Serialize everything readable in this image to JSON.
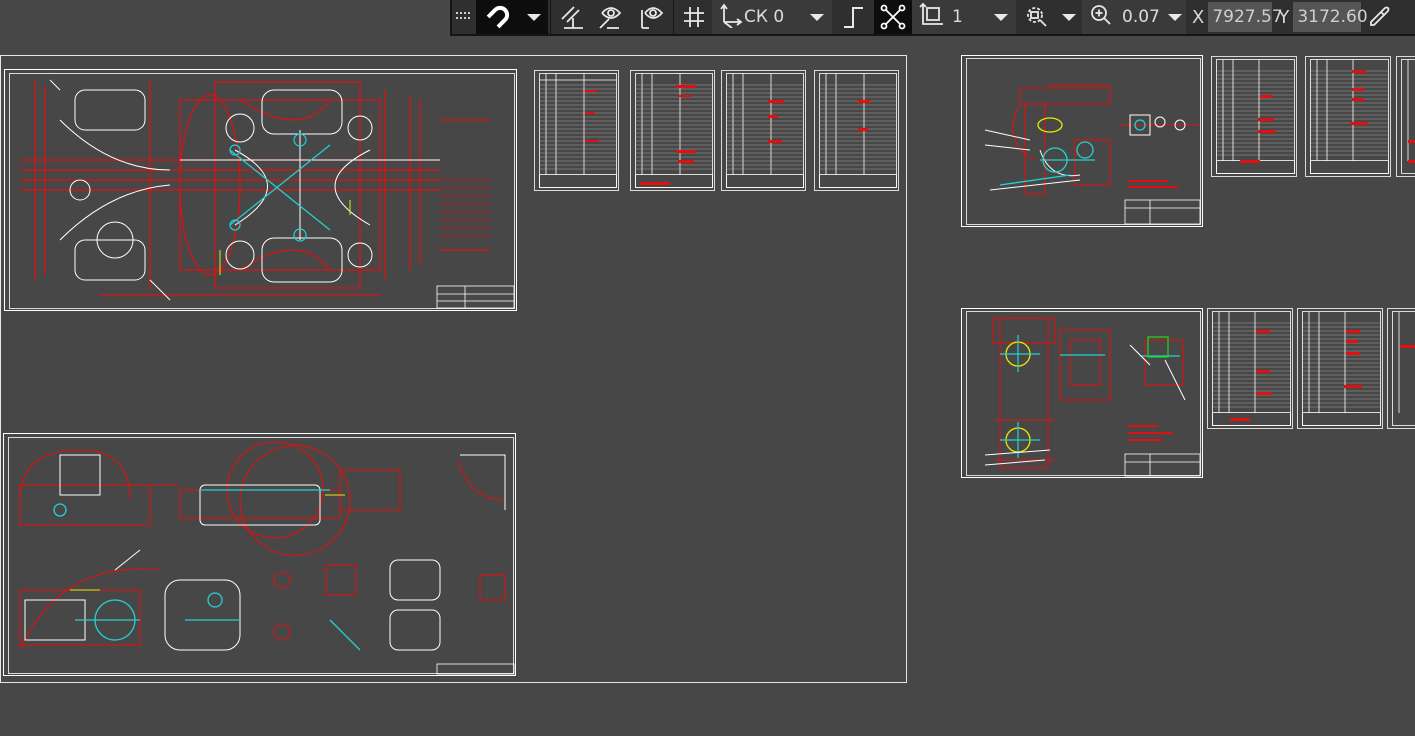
{
  "toolbar": {
    "coordinate_system": "СК 0",
    "layer_value": "1",
    "zoom_value": "0.07",
    "x_label": "X",
    "x_value": "7927.57",
    "y_label": "Y",
    "y_value": "3172.60"
  },
  "colors": {
    "canvas": "#474747",
    "drawing_red": "#e01010",
    "drawing_white": "#ffffff",
    "drawing_cyan": "#22d3d3",
    "drawing_yellow": "#e8e800",
    "drawing_green": "#20d020"
  },
  "icons": [
    "grip-icon",
    "magnet-snap-icon",
    "snap-dropdown-icon",
    "parallel-snap-icon",
    "hidden-view-icon",
    "view-icon",
    "grid-icon",
    "coordinate-system-icon",
    "orthogonal-icon",
    "tracking-icon",
    "layer-icon",
    "zoom-window-icon",
    "zoom-icon",
    "eyedropper-icon"
  ]
}
